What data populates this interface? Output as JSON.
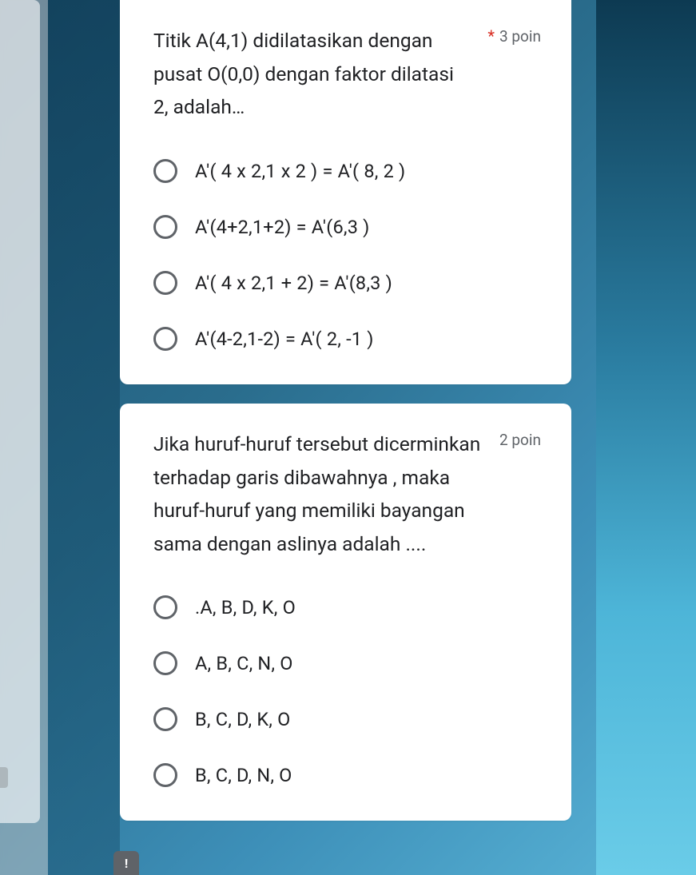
{
  "questions": [
    {
      "text": "Titik A(4,1) didilatasikan dengan pusat O(0,0) dengan faktor dilatasi 2, adalah…",
      "required": true,
      "points": "3 poin",
      "options": [
        "A'( 4 x 2,1 x 2 ) = A'( 8, 2 )",
        "A'(4+2,1+2) = A'(6,3 )",
        "A'( 4 x 2,1 + 2) = A'(8,3 )",
        "A'(4-2,1-2) = A'( 2, -1 )"
      ]
    },
    {
      "text": "Jika huruf-huruf tersebut dicerminkan terhadap garis dibawahnya , maka huruf-huruf yang memiliki bayangan sama dengan aslinya adalah ....",
      "required": false,
      "points": "2 poin",
      "options": [
        ".A, B, D, K, O",
        "A, B, C, N, O",
        "B, C, D, K, O",
        "B, C, D, N, O"
      ]
    }
  ],
  "required_marker": "*",
  "report_icon": "!"
}
